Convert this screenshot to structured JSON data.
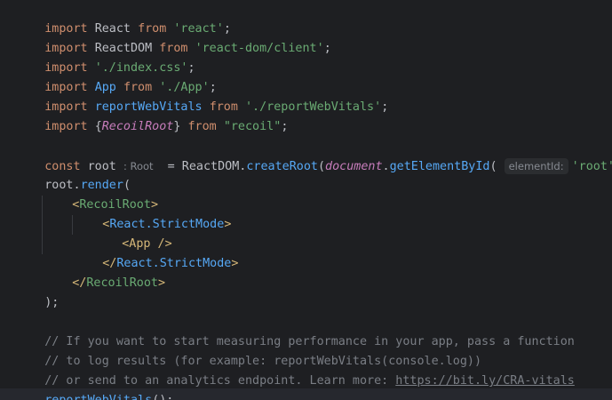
{
  "code": {
    "l1": {
      "kw": "import",
      "name": "React",
      "from": "from",
      "str": "'react'",
      "end": ";"
    },
    "l2": {
      "kw": "import",
      "name": "ReactDOM",
      "from": "from",
      "str": "'react-dom/client'",
      "end": ";"
    },
    "l3": {
      "kw": "import",
      "str": "'./index.css'",
      "end": ";"
    },
    "l4": {
      "kw": "import",
      "name": "App",
      "from": "from",
      "str": "'./App'",
      "end": ";"
    },
    "l5": {
      "kw": "import",
      "name": "reportWebVitals",
      "from": "from",
      "str": "'./reportWebVitals'",
      "end": ";"
    },
    "l6": {
      "kw": "import",
      "open": "{",
      "name": "RecoilRoot",
      "close": "}",
      "from": "from",
      "str": "\"recoil\"",
      "end": ";"
    },
    "l8": {
      "kw": "const",
      "name": "root",
      "type_hint": ": Root",
      "eq": " = ReactDOM.",
      "fn": "createRoot",
      "paren": "(",
      "doc": "document",
      "dot": ".",
      "fn2": "getElementById",
      "paren2": "(",
      "param_hint": "elementId:",
      "str": "'root'",
      "end": "));"
    },
    "l9": {
      "obj": "root.",
      "fn": "render",
      "paren": "("
    },
    "l10": {
      "open": "<",
      "tag": "RecoilRoot",
      "close": ">"
    },
    "l11": {
      "open": "<",
      "tag": "React.StrictMode",
      "close": ">"
    },
    "l12": {
      "tag": "<App />"
    },
    "l13": {
      "open": "</",
      "tag": "React.StrictMode",
      "close": ">"
    },
    "l14": {
      "open": "</",
      "tag": "RecoilRoot",
      "close": ">"
    },
    "l15": {
      "text": ");"
    },
    "l17": {
      "comment": "// If you want to start measuring performance in your app, pass a function"
    },
    "l18": {
      "comment": "// to log results (for example: reportWebVitals(console.log))"
    },
    "l19": {
      "comment": "// or send to an analytics endpoint. Learn more: ",
      "link": "https://bit.ly/CRA-vitals"
    },
    "l20": {
      "fn": "reportWebVitals",
      "end": "();"
    }
  }
}
